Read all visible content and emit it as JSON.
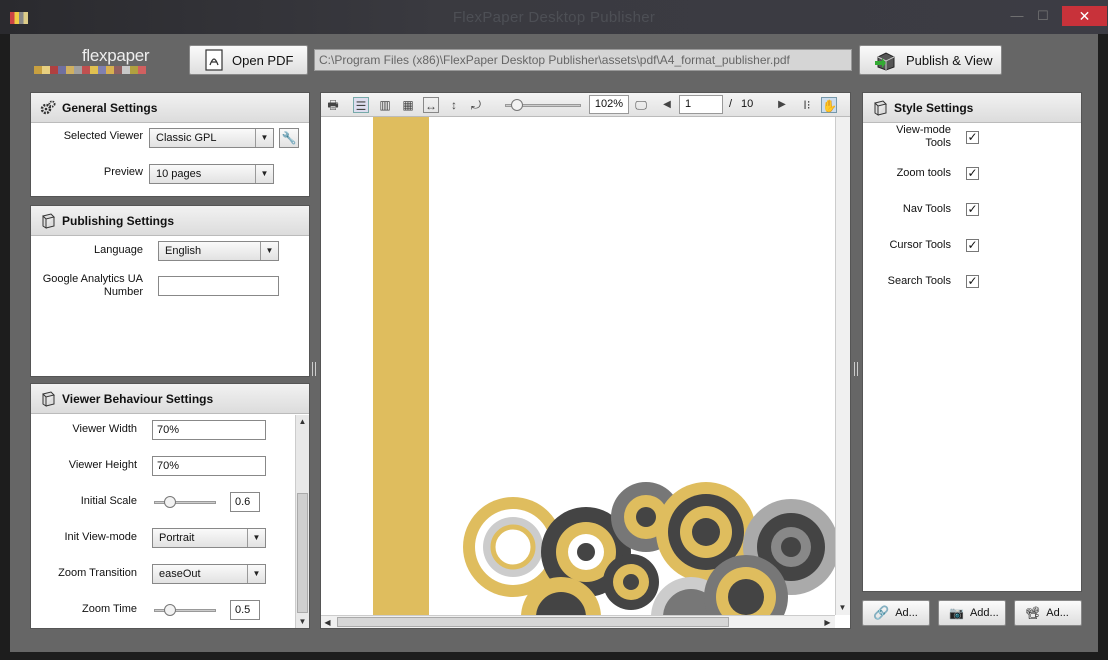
{
  "window": {
    "title": "FlexPaper Desktop Publisher",
    "minimize": "—",
    "maximize": "☐",
    "close": "✕"
  },
  "logo": {
    "text": "flexpaper",
    "colors": [
      "#c8a040",
      "#e8d080",
      "#b04040",
      "#7070a0",
      "#d0b060",
      "#a0a0a0",
      "#c05050",
      "#e0c050",
      "#8080b0",
      "#d8b050",
      "#906060",
      "#c8c8c8",
      "#b0a040",
      "#d06060"
    ]
  },
  "toolbar": {
    "open_pdf_label": "Open PDF",
    "pdf_path": "C:\\Program Files (x86)\\FlexPaper Desktop Publisher\\assets\\pdf\\A4_format_publisher.pdf",
    "publish_label": "Publish & View"
  },
  "general_settings": {
    "title": "General Settings",
    "selected_viewer_label": "Selected Viewer",
    "selected_viewer_value": "Classic GPL",
    "preview_label": "Preview",
    "preview_value": "10 pages",
    "icon": "gears-icon"
  },
  "publishing_settings": {
    "title": "Publishing Settings",
    "language_label": "Language",
    "language_value": "English",
    "ga_label_1": "Google Analytics UA",
    "ga_label_2": "Number",
    "ga_value": ""
  },
  "viewer_behaviour": {
    "title": "Viewer Behaviour Settings",
    "viewer_width_label": "Viewer Width",
    "viewer_width_value": "70%",
    "viewer_height_label": "Viewer Height",
    "viewer_height_value": "70%",
    "initial_scale_label": "Initial Scale",
    "initial_scale_value": "0.6",
    "initial_scale_level": 0.2,
    "init_view_mode_label": "Init View-mode",
    "init_view_mode_value": "Portrait",
    "zoom_transition_label": "Zoom Transition",
    "zoom_transition_value": "easeOut",
    "zoom_time_label": "Zoom Time",
    "zoom_time_value": "0.5",
    "zoom_time_level": 0.2
  },
  "viewer_toolbar": {
    "zoom_percent": "102%",
    "zoom_level": 0.1,
    "page_current": "1",
    "page_separator": "/",
    "page_total": "10"
  },
  "style_settings": {
    "title": "Style Settings",
    "items": [
      {
        "label_1": "View-mode",
        "label_2": "Tools",
        "checked": "✓"
      },
      {
        "label_1": "Zoom tools",
        "label_2": "",
        "checked": "✓"
      },
      {
        "label_1": "Nav Tools",
        "label_2": "",
        "checked": "✓"
      },
      {
        "label_1": "Cursor Tools",
        "label_2": "",
        "checked": "✓"
      },
      {
        "label_1": "Search Tools",
        "label_2": "",
        "checked": "✓"
      }
    ]
  },
  "bottom_buttons": [
    {
      "label": "Ad...",
      "icon": "link-icon"
    },
    {
      "label": "Add...",
      "icon": "camera-icon"
    },
    {
      "label": "Ad...",
      "icon": "projector-icon"
    }
  ],
  "accent": {
    "gold": "#dfbd5e",
    "dark": "#333333",
    "gray": "#777777",
    "close": "#c8323a"
  }
}
